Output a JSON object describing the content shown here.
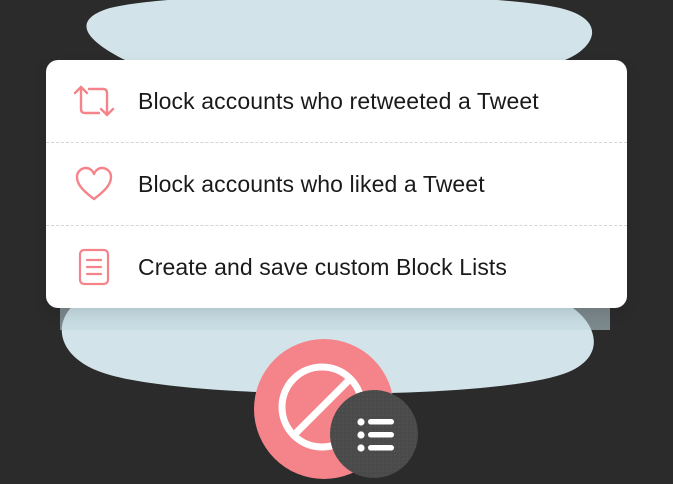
{
  "colors": {
    "background": "#2b2b2b",
    "blob": "#d2e4ea",
    "blob_shadow": "#bdd5dd",
    "accent": "#f4848a",
    "card": "#ffffff",
    "text": "#1a1a1a",
    "badge_dark": "#4a4a4a"
  },
  "menu": {
    "items": [
      {
        "label": "Block accounts who retweeted a Tweet",
        "icon": "retweet-icon"
      },
      {
        "label": "Block accounts who liked a Tweet",
        "icon": "heart-icon"
      },
      {
        "label": "Create and save custom Block Lists",
        "icon": "document-icon"
      }
    ]
  },
  "badges": {
    "main_icon": "block-icon",
    "secondary_icon": "list-icon"
  }
}
